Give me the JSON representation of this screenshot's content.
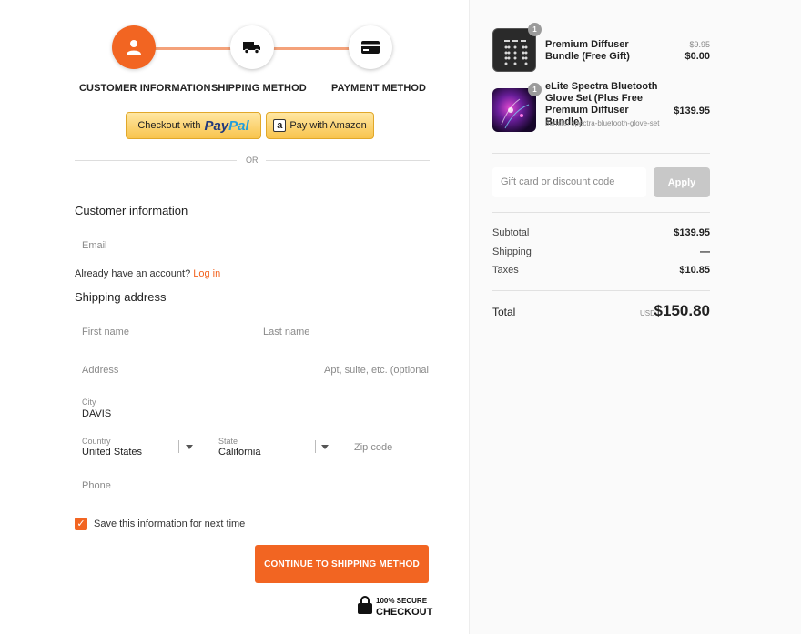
{
  "steps": [
    {
      "label": "CUSTOMER INFORMATION",
      "icon": "user-icon"
    },
    {
      "label": "SHIPPING METHOD",
      "icon": "truck-icon"
    },
    {
      "label": "PAYMENT METHOD",
      "icon": "card-icon"
    }
  ],
  "express": {
    "paypal_prefix": "Checkout with",
    "paypal_brand_1": "Pay",
    "paypal_brand_2": "Pal",
    "amazon_label": "Pay with Amazon",
    "amazon_mark": "a"
  },
  "divider_or": "OR",
  "customer": {
    "title": "Customer information",
    "email_placeholder": "Email",
    "account_prompt": "Already have an account?",
    "login_link": "Log in"
  },
  "shipping": {
    "title": "Shipping address",
    "first_name_placeholder": "First name",
    "last_name_placeholder": "Last name",
    "address_placeholder": "Address",
    "apt_placeholder": "Apt, suite, etc. (optional",
    "city_label": "City",
    "city_value": "DAVIS",
    "country_label": "Country",
    "country_value": "United States",
    "state_label": "State",
    "state_value": "California",
    "zip_placeholder": "Zip code",
    "phone_placeholder": "Phone",
    "save_info_label": "Save this information for next time",
    "save_info_checked": true
  },
  "continue_label": "CONTINUE TO SHIPPING METHOD",
  "secure": {
    "line1": "100% SECURE",
    "line2": "CHECKOUT"
  },
  "cart": {
    "items": [
      {
        "name": "Premium Diffuser Bundle (Free Gift)",
        "qty": "1",
        "price_old": "$9.95",
        "price": "$0.00",
        "meta": ""
      },
      {
        "name": "eLite Spectra Bluetooth Glove Set (Plus Free Premium Diffuser Bundle)",
        "qty": "1",
        "price": "$139.95",
        "meta": "bundle: spectra-bluetooth-glove-set"
      }
    ],
    "gift_placeholder": "Gift card or discount code",
    "apply_label": "Apply",
    "subtotal_label": "Subtotal",
    "subtotal_value": "$139.95",
    "shipping_label": "Shipping",
    "shipping_value": "—",
    "taxes_label": "Taxes",
    "taxes_value": "$10.85",
    "total_label": "Total",
    "total_currency": "USD",
    "total_value": "$150.80"
  },
  "colors": {
    "accent": "#f26522",
    "accent_light": "#f4a27a",
    "express_yellow": "#f8c44d",
    "sidebar_bg": "#fafafa"
  }
}
